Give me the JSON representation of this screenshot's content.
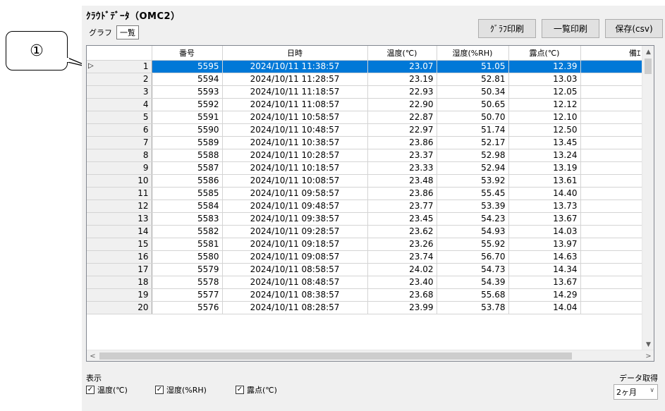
{
  "callout": {
    "label": "①"
  },
  "window": {
    "title": "ｸﾗｳﾄﾞﾃﾞｰﾀ（OMC2）"
  },
  "view_tabs": [
    {
      "label": "グラフ"
    },
    {
      "label": "一覧"
    }
  ],
  "toolbar": {
    "graph_print": "ｸﾞﾗﾌ印刷",
    "list_print": "一覧印刷",
    "save_csv": "保存(csv)"
  },
  "table": {
    "columns": [
      "",
      "番号",
      "日時",
      "温度(℃)",
      "湿度(%RH)",
      "露点(℃)",
      "備ｴ"
    ],
    "selected_row": 1,
    "rows": [
      {
        "n": "1",
        "id": "5595",
        "dt": "2024/10/11 11:38:57",
        "temp": "23.07",
        "hum": "51.05",
        "dew": "12.39"
      },
      {
        "n": "2",
        "id": "5594",
        "dt": "2024/10/11 11:28:57",
        "temp": "23.19",
        "hum": "52.81",
        "dew": "13.03"
      },
      {
        "n": "3",
        "id": "5593",
        "dt": "2024/10/11 11:18:57",
        "temp": "22.93",
        "hum": "50.34",
        "dew": "12.05"
      },
      {
        "n": "4",
        "id": "5592",
        "dt": "2024/10/11 11:08:57",
        "temp": "22.90",
        "hum": "50.65",
        "dew": "12.12"
      },
      {
        "n": "5",
        "id": "5591",
        "dt": "2024/10/11 10:58:57",
        "temp": "22.87",
        "hum": "50.70",
        "dew": "12.10"
      },
      {
        "n": "6",
        "id": "5590",
        "dt": "2024/10/11 10:48:57",
        "temp": "22.97",
        "hum": "51.74",
        "dew": "12.50"
      },
      {
        "n": "7",
        "id": "5589",
        "dt": "2024/10/11 10:38:57",
        "temp": "23.86",
        "hum": "52.17",
        "dew": "13.45"
      },
      {
        "n": "8",
        "id": "5588",
        "dt": "2024/10/11 10:28:57",
        "temp": "23.37",
        "hum": "52.98",
        "dew": "13.24"
      },
      {
        "n": "9",
        "id": "5587",
        "dt": "2024/10/11 10:18:57",
        "temp": "23.33",
        "hum": "52.94",
        "dew": "13.19"
      },
      {
        "n": "10",
        "id": "5586",
        "dt": "2024/10/11 10:08:57",
        "temp": "23.48",
        "hum": "53.92",
        "dew": "13.61"
      },
      {
        "n": "11",
        "id": "5585",
        "dt": "2024/10/11 09:58:57",
        "temp": "23.86",
        "hum": "55.45",
        "dew": "14.40"
      },
      {
        "n": "12",
        "id": "5584",
        "dt": "2024/10/11 09:48:57",
        "temp": "23.77",
        "hum": "53.39",
        "dew": "13.73"
      },
      {
        "n": "13",
        "id": "5583",
        "dt": "2024/10/11 09:38:57",
        "temp": "23.45",
        "hum": "54.23",
        "dew": "13.67"
      },
      {
        "n": "14",
        "id": "5582",
        "dt": "2024/10/11 09:28:57",
        "temp": "23.62",
        "hum": "54.93",
        "dew": "14.03"
      },
      {
        "n": "15",
        "id": "5581",
        "dt": "2024/10/11 09:18:57",
        "temp": "23.26",
        "hum": "55.92",
        "dew": "13.97"
      },
      {
        "n": "16",
        "id": "5580",
        "dt": "2024/10/11 09:08:57",
        "temp": "23.74",
        "hum": "56.70",
        "dew": "14.63"
      },
      {
        "n": "17",
        "id": "5579",
        "dt": "2024/10/11 08:58:57",
        "temp": "24.02",
        "hum": "54.73",
        "dew": "14.34"
      },
      {
        "n": "18",
        "id": "5578",
        "dt": "2024/10/11 08:48:57",
        "temp": "23.40",
        "hum": "54.39",
        "dew": "13.67"
      },
      {
        "n": "19",
        "id": "5577",
        "dt": "2024/10/11 08:38:57",
        "temp": "23.68",
        "hum": "55.68",
        "dew": "14.29"
      },
      {
        "n": "20",
        "id": "5576",
        "dt": "2024/10/11 08:28:57",
        "temp": "23.99",
        "hum": "53.78",
        "dew": "14.04"
      }
    ]
  },
  "display": {
    "label": "表示",
    "checks": [
      {
        "label": "温度(℃)",
        "checked": true
      },
      {
        "label": "湿度(%RH)",
        "checked": true
      },
      {
        "label": "露点(℃)",
        "checked": true
      }
    ]
  },
  "acquisition": {
    "label": "データ取得",
    "value": "2ヶ月"
  },
  "colors": {
    "selection": "#0078d7",
    "window_bg": "#f0f0f0"
  }
}
